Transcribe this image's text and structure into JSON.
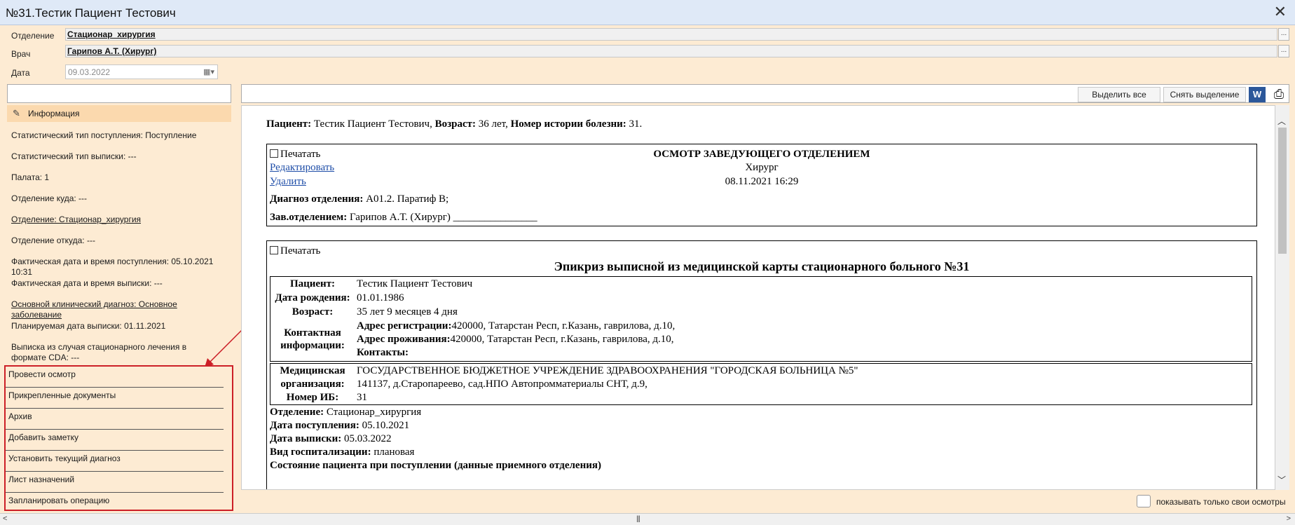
{
  "window": {
    "title": "№31.Тестик Пациент Тестович",
    "close": "✕"
  },
  "header": {
    "department_label": "Отделение",
    "department_value": "Стационар_хирургия",
    "doctor_label": "Врач",
    "doctor_value": "Гарипов А.Т. (Хирург)",
    "date_label": "Дата",
    "date_value": "09.03.2022",
    "picker": "..."
  },
  "left": {
    "info_tab": "Информация",
    "info_lines": [
      "Статистический тип поступления: Поступление",
      "Статистический тип выписки: ---",
      "Палата: 1",
      "Отделение куда: ---",
      "Отделение: Стационар_хирургия",
      "Отделение откуда: ---",
      "Фактическая дата и время поступления: 05.10.2021",
      "10:31",
      "Фактическая дата и время выписки: ---",
      "Основной клинический диагноз: Основное",
      "заболевание",
      "Планируемая дата выписки: 01.11.2021",
      "Выписка из случая стационарного лечения в",
      "формате CDA: ---"
    ],
    "actions": [
      "Провести осмотр",
      "Прикрепленные документы",
      "Архив",
      "Добавить заметку",
      "Установить текущий диагноз",
      "Лист назначений",
      "Запланировать операцию"
    ]
  },
  "toolbar": {
    "select_all": "Выделить все",
    "deselect": "Снять выделение",
    "word": "W"
  },
  "doc": {
    "patient_label": "Пациент:",
    "patient_value": " Тестик Пациент Тестович, ",
    "age_label": "Возраст:",
    "age_value": " 36 лет, ",
    "history_label": "Номер истории болезни:",
    "history_value": " 31.",
    "print_label": "Печатать",
    "exam": {
      "title": "ОСМОТР ЗАВЕДУЮЩЕГО ОТДЕЛЕНИЕМ",
      "edit": "Редактировать",
      "delete": "Удалить",
      "specialty": "Хирург",
      "datetime": "08.11.2021 16:29",
      "diag_label": "Диагноз отделения:",
      "diag_value": " A01.2. Паратиф B;",
      "head_label": "Зав.отделением:",
      "head_value": " Гарипов А.Т. (Хирург) ________________"
    },
    "epicrisis": {
      "title": "Эпикриз выписной из медицинской карты стационарного больного №31",
      "rows": [
        {
          "label": "Пациент:",
          "value": "Тестик Пациент Тестович"
        },
        {
          "label": "Дата рождения:",
          "value": "01.01.1986"
        },
        {
          "label": "Возраст:",
          "value": "35 лет 9 месяцев 4 дня"
        }
      ],
      "contact_label_1": "Контактная",
      "contact_label_2": "информации:",
      "reg_label": "Адрес регистрации:",
      "reg_value": "420000, Татарстан Респ, г.Казань, гаврилова, д.10,",
      "live_label": "Адрес проживания:",
      "live_value": "420000, Татарстан Респ, г.Казань, гаврилова, д.10,",
      "contacts_label": "Контакты:",
      "org_label_1": "Медицинская",
      "org_label_2": "организация:",
      "org_value_1": "ГОСУДАРСТВЕННОЕ БЮДЖЕТНОЕ УЧРЕЖДЕНИЕ ЗДРАВООХРАНЕНИЯ \"ГОРОДСКАЯ БОЛЬНИЦА №5\"",
      "org_value_2": "141137, д.Старопареево, сад.НПО Автопромматериалы СНТ, д.9,",
      "ib_label": "Номер ИБ:",
      "ib_value": "31",
      "dept_label": "Отделение:",
      "dept_value": " Стационар_хирургия",
      "admit_label": "Дата поступления:",
      "admit_value": " 05.10.2021",
      "discharge_label": "Дата выписки:",
      "discharge_value": " 05.03.2022",
      "hosp_label": "Вид госпитализации:",
      "hosp_value": " плановая",
      "state_label": "Состояние пациента при поступлении (данные приемного отделения)"
    }
  },
  "footer": {
    "own_only": "показывать только свои осмотры"
  }
}
